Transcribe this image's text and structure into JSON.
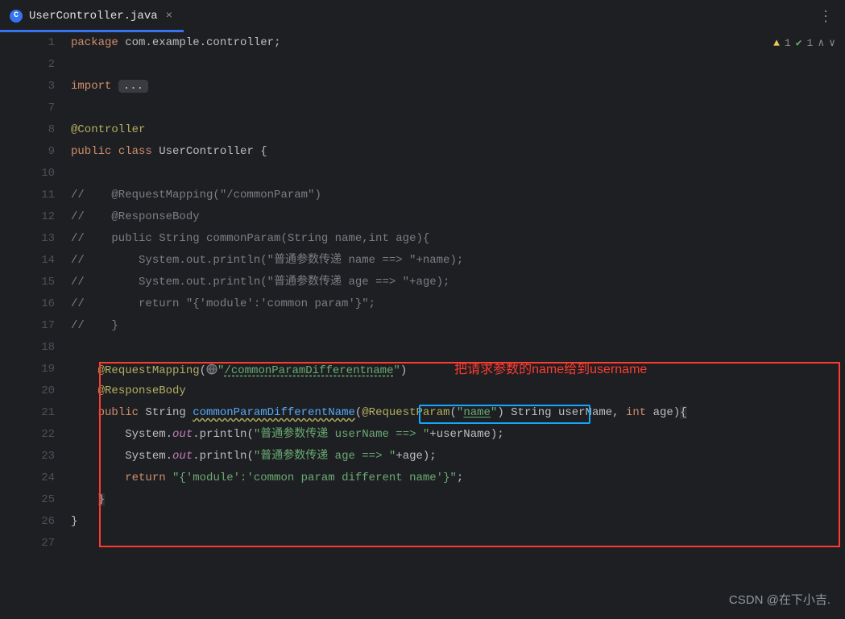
{
  "tab": {
    "icon_letter": "C",
    "title": "UserController.java"
  },
  "inspections": {
    "warnings": "1",
    "passed": "1"
  },
  "gutter_numbers": [
    "1",
    "2",
    "3",
    "7",
    "8",
    "9",
    "10",
    "11",
    "12",
    "13",
    "14",
    "15",
    "16",
    "17",
    "18",
    "19",
    "20",
    "21",
    "22",
    "23",
    "24",
    "25",
    "26",
    "27"
  ],
  "annotations": {
    "red_label": "把请求参数的name给到username"
  },
  "code": {
    "l1_kw_package": "package ",
    "l1_pkg": "com.example.controller",
    "l1_semi": ";",
    "l3_kw_import": "import ",
    "l3_dots": "...",
    "l8_ann_controller": "@Controller",
    "l9_kw_public": "public ",
    "l9_kw_class": "class ",
    "l9_classname": "UserController ",
    "l9_brace": "{",
    "l11": "//    @RequestMapping(\"/commonParam\")",
    "l12": "//    @ResponseBody",
    "l13": "//    public String commonParam(String name,int age){",
    "l14": "//        System.out.println(\"普通参数传递 name ==> \"+name);",
    "l15": "//        System.out.println(\"普通参数传递 age ==> \"+age);",
    "l16": "//        return \"{'module':'common param'}\";",
    "l17": "//    }",
    "l19_ann": "@RequestMapping",
    "l19_paren_open": "(",
    "l19_value": "/commonParamDifferentname",
    "l19_q_open": "\"",
    "l19_q_close": "\"",
    "l19_paren_close": ")",
    "l20_ann": "@ResponseBody",
    "l21_kw_public": "public ",
    "l21_type_string": "String ",
    "l21_method": "commonParamDifferentName",
    "l21_open": "(",
    "l21_reqparam": "@RequestParam",
    "l21_rp_open": "(",
    "l21_rp_q1": "\"",
    "l21_rp_name": "name",
    "l21_rp_q2": "\"",
    "l21_rp_close": ")",
    "l21_sp": " ",
    "l21_p1_type": "String ",
    "l21_p1_name": "userName",
    "l21_c1": ", ",
    "l21_p2_type": "int ",
    "l21_p2_name": "age",
    "l21_close": ")",
    "l21_brace": "{",
    "l22_sys": "System.",
    "l22_out": "out",
    "l22_print": ".println(",
    "l22_str": "\"普通参数传递 userName ==> \"",
    "l22_plus": "+userName);",
    "l23_sys": "System.",
    "l23_out": "out",
    "l23_print": ".println(",
    "l23_str": "\"普通参数传递 age ==> \"",
    "l23_plus": "+age);",
    "l24_kw_return": "return ",
    "l24_str": "\"{'module':'common param different name'}\"",
    "l24_semi": ";",
    "l25_brace": "}",
    "l26_brace": "}"
  },
  "watermark": "CSDN @在下小吉."
}
